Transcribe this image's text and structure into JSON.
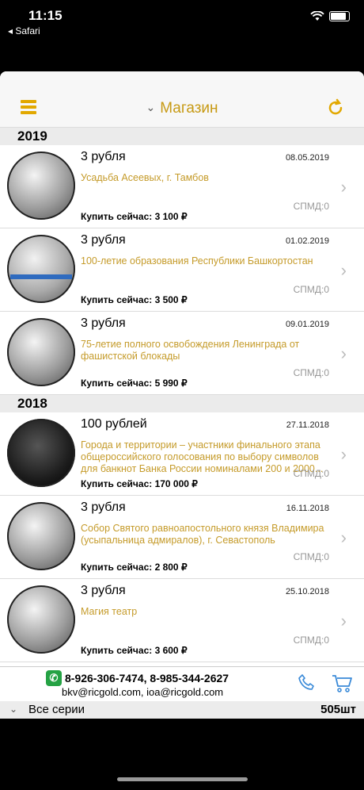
{
  "status": {
    "time": "11:15",
    "back_label": "◂ Safari"
  },
  "header": {
    "title": "Магазин"
  },
  "sections": [
    {
      "year": "2019",
      "items": [
        {
          "denomination": "3 рубля",
          "date": "08.05.2019",
          "name": "Усадьба Асеевых, г. Тамбов",
          "spmd": "СПМД:0",
          "price": "Купить сейчас: 3 100 ₽"
        },
        {
          "denomination": "3 рубля",
          "date": "01.02.2019",
          "name": "100-летие образования Республики Башкортостан",
          "spmd": "СПМД:0",
          "price": "Купить сейчас: 3 500 ₽"
        },
        {
          "denomination": "3 рубля",
          "date": "09.01.2019",
          "name": "75-летие полного освобождения Ленинграда от фашистской блокады",
          "spmd": "СПМД:0",
          "price": "Купить сейчас: 5 990 ₽"
        }
      ]
    },
    {
      "year": "2018",
      "items": [
        {
          "denomination": "100 рублей",
          "date": "27.11.2018",
          "name": "Города и территории – участники финального этапа общероссийского голосования по выбору символов для банкнот Банка России номиналами 200 и 2000...",
          "spmd": "СПМД:0",
          "price": "Купить сейчас: 170 000 ₽"
        },
        {
          "denomination": "3 рубля",
          "date": "16.11.2018",
          "name": "Собор Святого равноапостольного князя Владимира (усыпальница адмиралов), г. Севастополь",
          "spmd": "СПМД:0",
          "price": "Купить сейчас: 2 800 ₽"
        },
        {
          "denomination": "3 рубля",
          "date": "25.10.2018",
          "name": "Магия театр",
          "spmd": "СПМД:0",
          "price": "Купить сейчас: 3 600 ₽"
        }
      ]
    }
  ],
  "footer": {
    "phones": "8-926-306-7474, 8-985-344-2627",
    "emails": "bkv@ricgold.com, ioa@ricgold.com"
  },
  "series_bar": {
    "label": "Все серии",
    "count": "505шт"
  }
}
